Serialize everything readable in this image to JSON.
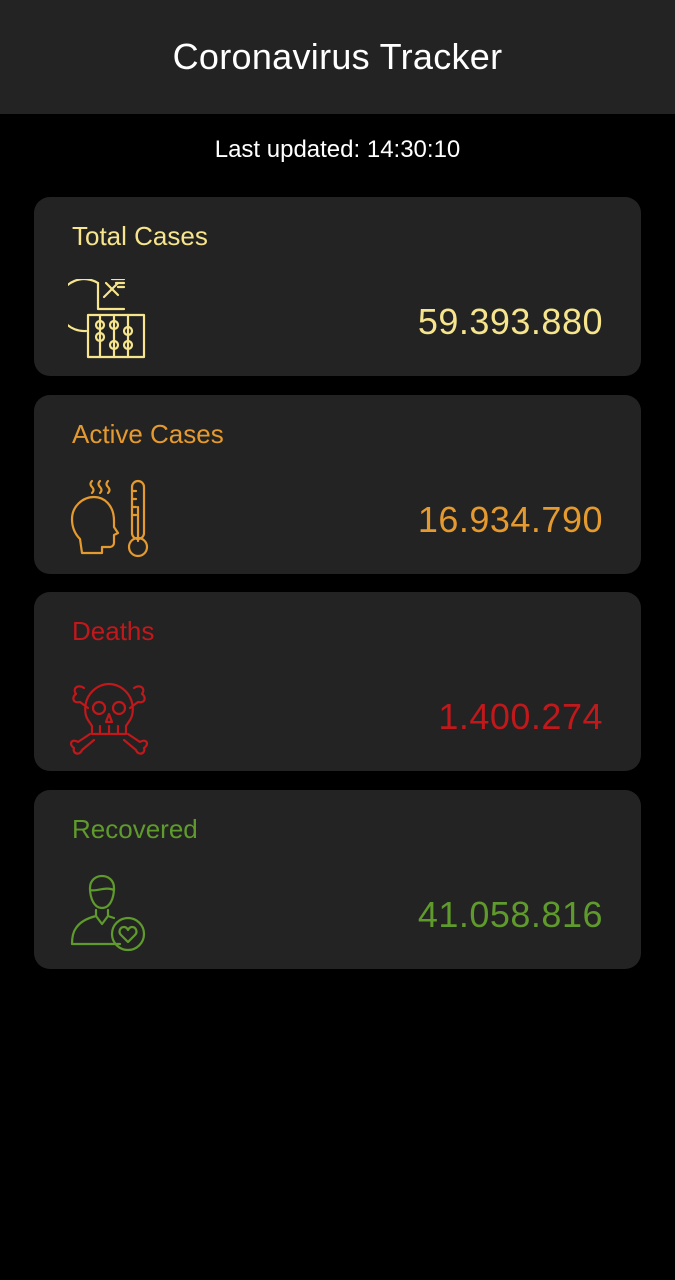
{
  "app": {
    "title": "Coronavirus Tracker",
    "last_updated": "Last updated: 14:30:10"
  },
  "cards": [
    {
      "label": "Total Cases",
      "value": "59.393.880",
      "color": "#f6e58d",
      "icon": "chart-abacus-icon"
    },
    {
      "label": "Active Cases",
      "value": "16.934.790",
      "color": "#e59a2f",
      "icon": "fever-thermometer-icon"
    },
    {
      "label": "Deaths",
      "value": "1.400.274",
      "color": "#c0181b",
      "icon": "skull-crossbones-icon"
    },
    {
      "label": "Recovered",
      "value": "41.058.816",
      "color": "#5f9a2c",
      "icon": "person-heart-icon"
    }
  ]
}
